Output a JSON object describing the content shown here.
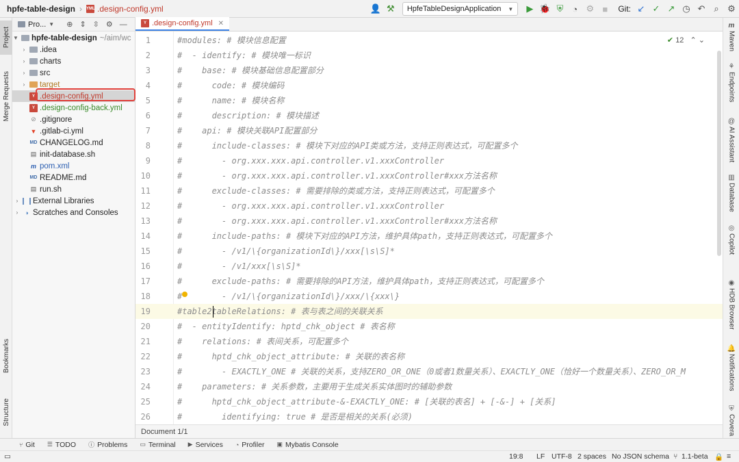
{
  "topbar": {
    "project": "hpfe-table-design",
    "file": ".design-config.yml",
    "run_config": "HpfeTableDesignApplication",
    "git_label": "Git:"
  },
  "project_panel": {
    "title": "Pro...",
    "root": {
      "name": "hpfe-table-design",
      "path": "~/aim/wc"
    },
    "items": [
      {
        "name": ".idea",
        "kind": "folder",
        "level": 1,
        "expandable": true
      },
      {
        "name": "charts",
        "kind": "folder",
        "level": 1,
        "expandable": true
      },
      {
        "name": "src",
        "kind": "folder",
        "level": 1,
        "expandable": true
      },
      {
        "name": "target",
        "kind": "folder-orange",
        "level": 1,
        "expandable": true
      },
      {
        "name": ".design-config.yml",
        "kind": "yml",
        "level": 1,
        "selected": true
      },
      {
        "name": ".design-config-back.yml",
        "kind": "yml",
        "level": 1
      },
      {
        "name": ".gitignore",
        "kind": "file",
        "level": 1
      },
      {
        "name": ".gitlab-ci.yml",
        "kind": "gitlab",
        "level": 1
      },
      {
        "name": "CHANGELOG.md",
        "kind": "md",
        "level": 1
      },
      {
        "name": "init-database.sh",
        "kind": "sh",
        "level": 1
      },
      {
        "name": "pom.xml",
        "kind": "maven",
        "level": 1
      },
      {
        "name": "README.md",
        "kind": "md",
        "level": 1
      },
      {
        "name": "run.sh",
        "kind": "sh",
        "level": 1
      },
      {
        "name": "External Libraries",
        "kind": "lib",
        "level": 0,
        "expandable": true
      },
      {
        "name": "Scratches and Consoles",
        "kind": "scratch",
        "level": 0,
        "expandable": true
      }
    ]
  },
  "left_stripe": {
    "project": "Project",
    "merge": "Merge Requests",
    "bookmarks": "Bookmarks",
    "structure": "Structure"
  },
  "editor": {
    "tab_label": ".design-config.yml",
    "inspections": "12",
    "current_line": 19,
    "lines": [
      "#modules: # 模块信息配置",
      "#  - identify: # 模块唯一标识",
      "#    base: # 模块基础信息配置部分",
      "#      code: # 模块编码",
      "#      name: # 模块名称",
      "#      description: # 模块描述",
      "#    api: # 模块关联API配置部分",
      "#      include-classes: # 模块下对应的API类或方法，支持正则表达式，可配置多个",
      "#        - org.xxx.xxx.api.controller.v1.xxxController",
      "#        - org.xxx.xxx.api.controller.v1.xxxController#xxx方法名称",
      "#      exclude-classes: # 需要排除的类或方法，支持正则表达式，可配置多个",
      "#        - org.xxx.xxx.api.controller.v1.xxxController",
      "#        - org.xxx.xxx.api.controller.v1.xxxController#xxx方法名称",
      "#      include-paths: # 模块下对应的API方法，维护具体path，支持正则表达式，可配置多个",
      "#        - /v1/\\{organizationId\\}/xxx[\\s\\S]*",
      "#        - /v1/xxx[\\s\\S]*",
      "#      exclude-paths: # 需要排除的API方法，维护具体path，支持正则表达式，可配置多个",
      "#        - /v1/\\{organizationId\\}/xxx/\\{xxx\\}",
      "#table2tableRelations: # 表与表之间的关联关系",
      "#  - entityIdentify: hptd_chk_object # 表名称",
      "#    relations: # 表间关系，可配置多个",
      "#      hptd_chk_object_attribute: # 关联的表名称",
      "#        - EXACTLY_ONE # 关联的关系，支持ZERO_OR_ONE（0或者1数量关系）、EXACTLY_ONE（恰好一个数量关系）、ZERO_OR_M",
      "#    parameters: # 关系参数，主要用于生成关系实体图时的辅助参数",
      "#      hptd_chk_object_attribute-&-EXACTLY_ONE: # [关联的表名] + [-&-] + [关系]",
      "#        identifying: true # 是否是相关的关系(必须)"
    ]
  },
  "doc_footer": "Document 1/1",
  "right_stripe": [
    "Maven",
    "Endpoints",
    "AI Assistant",
    "Database",
    "Copilot",
    "HDB Browser",
    "Notifications",
    "Covera"
  ],
  "bottom_tools": [
    "Git",
    "TODO",
    "Problems",
    "Terminal",
    "Services",
    "Profiler",
    "Mybatis Console"
  ],
  "status": {
    "position": "19:8",
    "line_sep": "LF",
    "encoding": "UTF-8",
    "indent": "2 spaces",
    "schema": "No JSON schema",
    "version": "1.1-beta"
  }
}
